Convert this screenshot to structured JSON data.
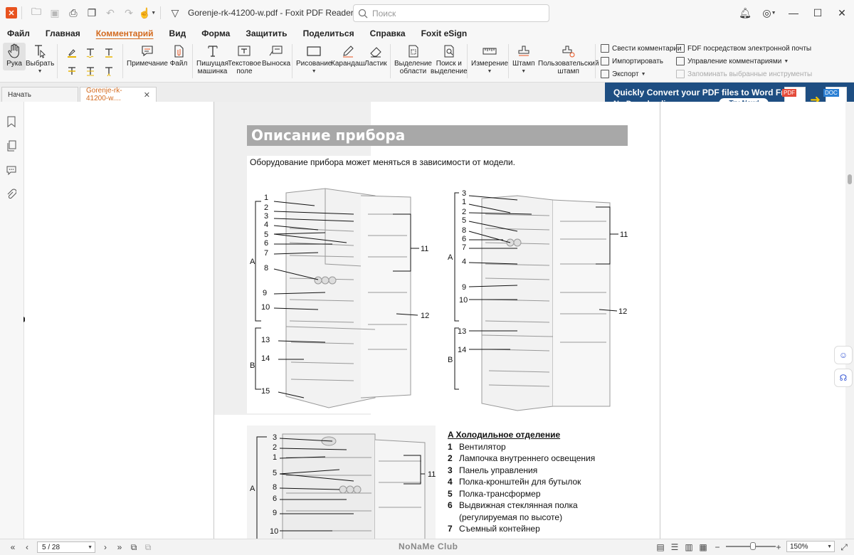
{
  "titlebar": {
    "document_title": "Gorenje-rk-41200-w.pdf - Foxit PDF Reader",
    "search_placeholder": "Поиск"
  },
  "menu": {
    "items": [
      "Файл",
      "Главная",
      "Комментарий",
      "Вид",
      "Форма",
      "Защитить",
      "Поделиться",
      "Справка",
      "Foxit eSign"
    ],
    "active": "Комментарий"
  },
  "ribbon": {
    "hand": "Рука",
    "select": "Выбрать",
    "note": "Примечание",
    "file": "Файл",
    "typewriter_1": "Пишущая",
    "typewriter_2": "машинка",
    "textbox_1": "Текстовое",
    "textbox_2": "поле",
    "callout": "Выноска",
    "drawing": "Рисование",
    "pencil": "Карандаш",
    "eraser": "Ластик",
    "area_1": "Выделение",
    "area_2": "области",
    "find_1": "Поиск и",
    "find_2": "выделение",
    "measure": "Измерение",
    "stamp": "Штамп",
    "custom_stamp_1": "Пользовательский",
    "custom_stamp_2": "штамп",
    "summarize": "Свести комментарии",
    "import": "Импортировать",
    "export": "Экспорт",
    "email": "FDF посредством электронной почты",
    "manage": "Управление комментариями",
    "remember": "Запоминать выбранные инструменты"
  },
  "tabs": {
    "start": "Начать",
    "doc": "Gorenje-rk-41200-w...."
  },
  "ad": {
    "line1": "Quickly Convert your PDF files to Word Free.",
    "line2": "No Downloading necessary.",
    "button": "Try Now!",
    "pdf_badge": "PDF",
    "doc_badge": "DOC"
  },
  "page": {
    "title": "Описание прибора",
    "subtitle": "Оборудование прибора может меняться в зависимости от модели.",
    "fig1_labels": [
      "1",
      "2",
      "3",
      "4",
      "5",
      "6",
      "7",
      "8",
      "9",
      "10",
      "13",
      "14",
      "15",
      "11",
      "12",
      "A",
      "B"
    ],
    "fig2_labels": [
      "3",
      "1",
      "2",
      "5",
      "8",
      "6",
      "7",
      "4",
      "9",
      "10",
      "13",
      "14",
      "11",
      "12",
      "A",
      "B"
    ],
    "fig3_labels": [
      "3",
      "2",
      "1",
      "5",
      "8",
      "6",
      "9",
      "10",
      "11",
      "A"
    ],
    "legend_head": "A  Холодильное отделение",
    "legend": [
      {
        "n": "1",
        "t": "Вентилятор"
      },
      {
        "n": "2",
        "t": "Лампочка внутреннего освещения"
      },
      {
        "n": "3",
        "t": "Панель управления"
      },
      {
        "n": "4",
        "t": "Полка-кронштейн для бутылок"
      },
      {
        "n": "5",
        "t": "Полка-трансформер"
      },
      {
        "n": "6",
        "t": "Выдвижная стеклянная полка"
      },
      {
        "n": "",
        "t": "(регулируемая по высоте)"
      },
      {
        "n": "7",
        "t": "Съемный контейнер"
      }
    ]
  },
  "status": {
    "page_indicator": "5 / 28",
    "zoom": "150%",
    "watermark": "NoNaMe Club"
  }
}
